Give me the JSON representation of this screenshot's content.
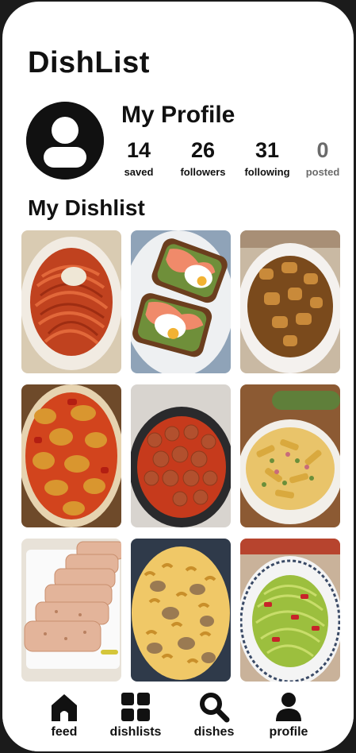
{
  "app": {
    "title": "DishList"
  },
  "profile": {
    "title": "My Profile",
    "avatar_icon": "user-icon",
    "stats": [
      {
        "value": "14",
        "label": "saved"
      },
      {
        "value": "26",
        "label": "followers"
      },
      {
        "value": "31",
        "label": "following"
      },
      {
        "value": "0",
        "label": "posted"
      }
    ]
  },
  "dishlist": {
    "title": "My Dishlist",
    "items": [
      {
        "name": "spaghetti-with-tomato-sauce"
      },
      {
        "name": "smoked-salmon-avocado-toast-poached-egg"
      },
      {
        "name": "chicken-stew"
      },
      {
        "name": "chicken-with-peppers"
      },
      {
        "name": "meatballs-in-tomato-sauce"
      },
      {
        "name": "penne-with-zucchini-and-ham"
      },
      {
        "name": "meatloaf-slices"
      },
      {
        "name": "macaroni-with-sausage"
      },
      {
        "name": "zucchini-noodles-with-tomatoes"
      }
    ]
  },
  "tabbar": {
    "items": [
      {
        "label": "feed",
        "icon": "home-icon"
      },
      {
        "label": "dishlists",
        "icon": "grid-icon"
      },
      {
        "label": "dishes",
        "icon": "search-icon"
      },
      {
        "label": "profile",
        "icon": "person-icon"
      }
    ]
  },
  "colors": {
    "background": "#ffffff",
    "text": "#111111",
    "muted": "#6b6b6b",
    "frame": "#1b1b1b"
  }
}
